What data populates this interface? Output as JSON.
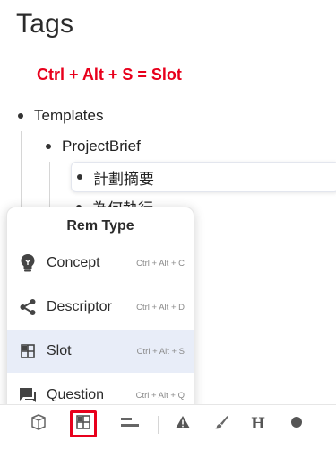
{
  "page": {
    "title": "Tags"
  },
  "hint": {
    "text": "Ctrl + Alt + S = Slot",
    "color": "#e8001c"
  },
  "tree": {
    "root": "Templates",
    "child": "ProjectBrief",
    "items": [
      "計劃摘要",
      "為何執行"
    ]
  },
  "rem_type_menu": {
    "title": "Rem Type",
    "items": [
      {
        "label": "Concept",
        "shortcut": "Ctrl + Alt + C",
        "icon": "lightbulb-icon"
      },
      {
        "label": "Descriptor",
        "shortcut": "Ctrl + Alt + D",
        "icon": "share-nodes-icon"
      },
      {
        "label": "Slot",
        "shortcut": "Ctrl + Alt + S",
        "icon": "slot-grid-icon",
        "selected": true
      },
      {
        "label": "Question",
        "shortcut": "Ctrl + Alt + Q",
        "icon": "question-chat-icon"
      }
    ]
  },
  "toolbar": {
    "buttons": [
      "cube-icon",
      "slot-grid-icon",
      "divider-lines-icon",
      "warning-icon",
      "brush-icon",
      "heading-icon",
      "circle-icon"
    ],
    "heading_glyph": "H",
    "highlight_color": "#e8001c"
  }
}
